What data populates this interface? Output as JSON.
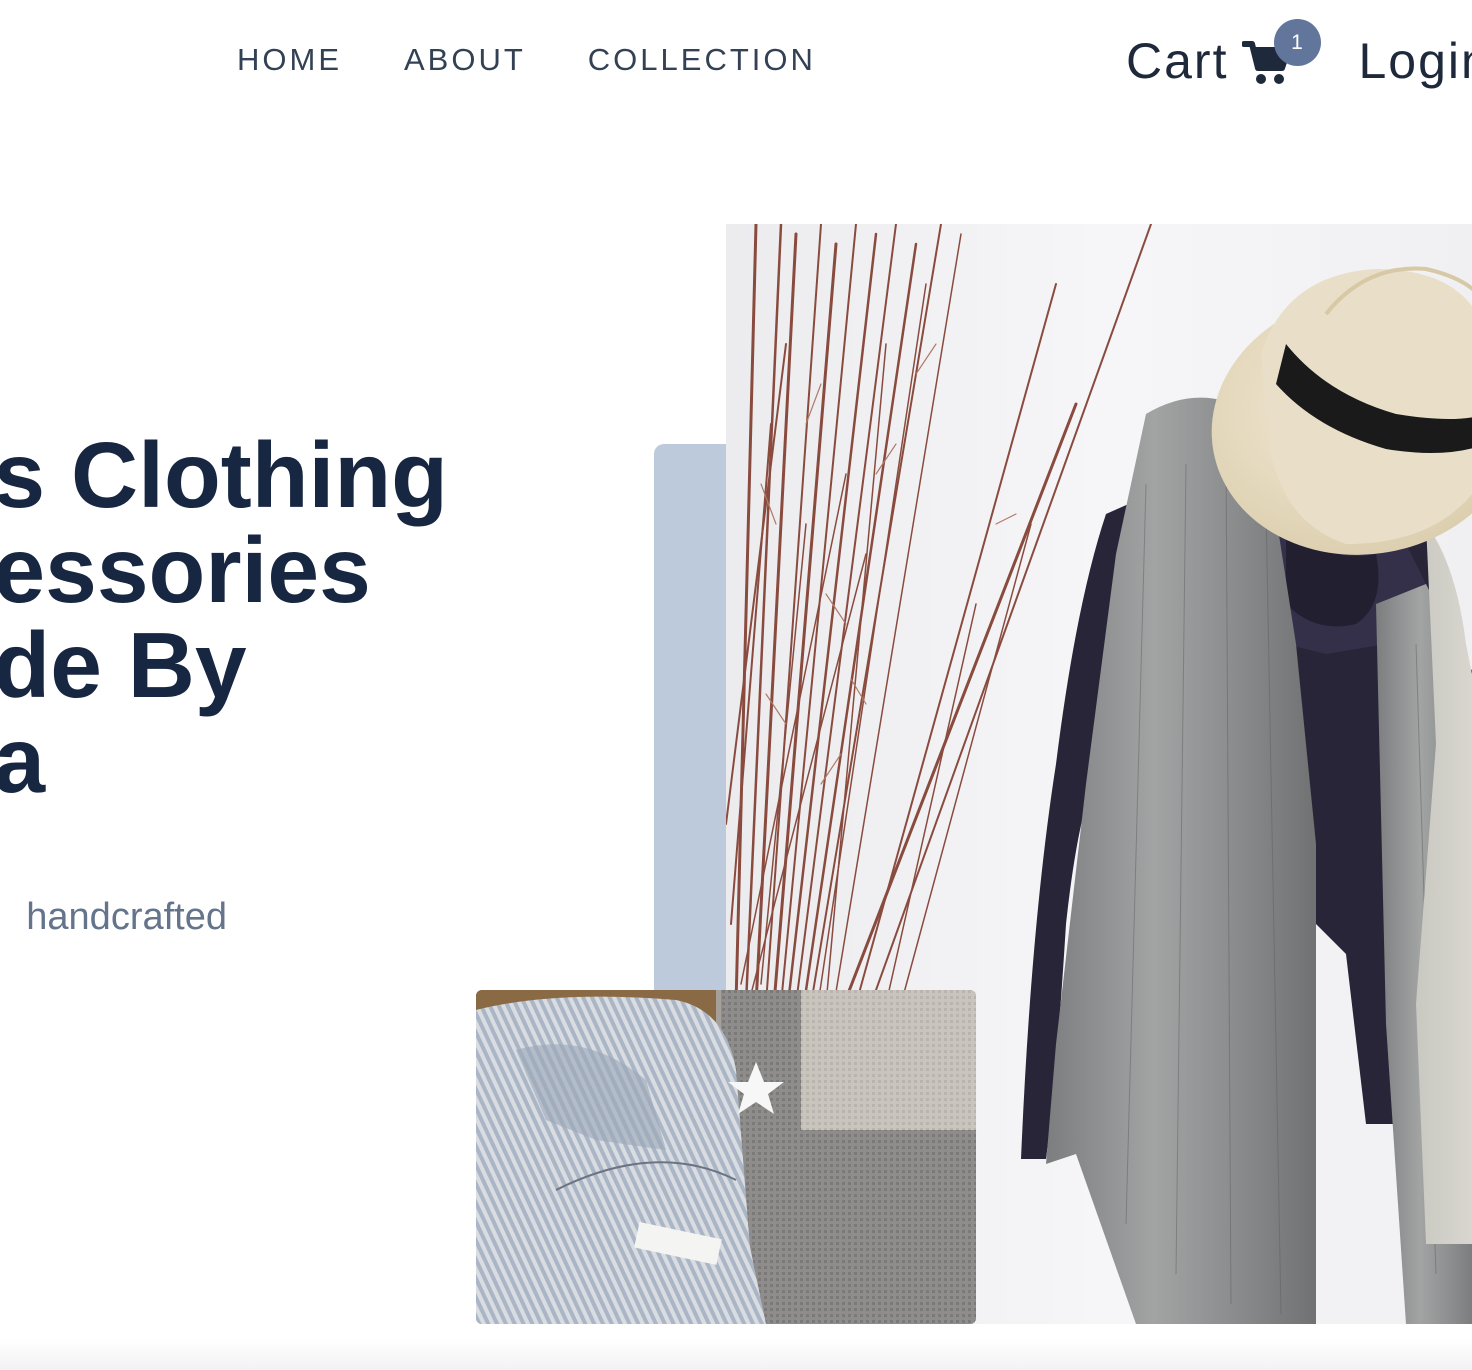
{
  "nav": {
    "links": [
      "HOME",
      "ABOUT",
      "COLLECTION"
    ],
    "cart_label": "Cart",
    "cart_count": "1",
    "login_label": "Login"
  },
  "hero": {
    "title_lines": [
      "s Clothing",
      "essories",
      "de By",
      "a"
    ],
    "subtitle": "handcrafted",
    "accent_color": "#bccadb",
    "title_color": "#172641"
  },
  "images": {
    "main": "hanging-jacket-hat-scarf-photo",
    "secondary": "folded-linen-garments-photo"
  }
}
